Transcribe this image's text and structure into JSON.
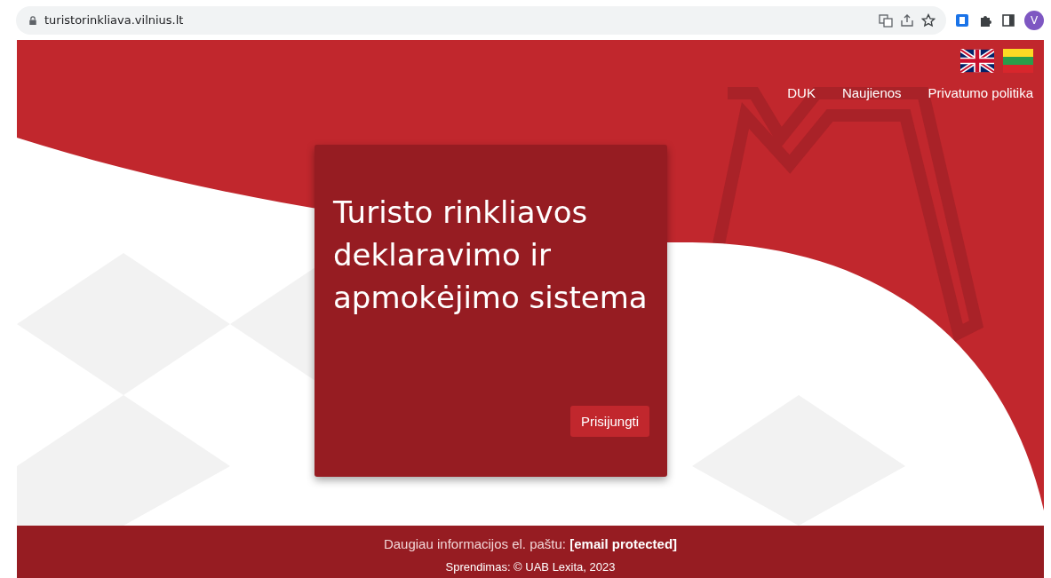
{
  "browser": {
    "url": "turistorinkliava.vilnius.lt",
    "avatar": "V"
  },
  "nav": [
    {
      "label": "DUK"
    },
    {
      "label": "Naujienos"
    },
    {
      "label": "Privatumo politika"
    }
  ],
  "card": {
    "title": "Turisto rinkliavos deklaravimo ir apmokėjimo sistema",
    "button": "Prisijungti"
  },
  "footer": {
    "contact": "Daugiau informacijos el. paštu: **[email protected]**",
    "credit": "Sprendimas: © UAB Lexita, 2023"
  }
}
